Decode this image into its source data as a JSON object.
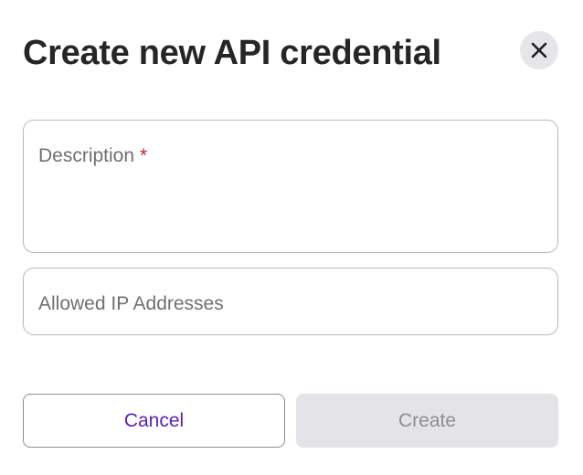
{
  "dialog": {
    "title": "Create new API credential",
    "close_icon": "close-icon"
  },
  "form": {
    "description": {
      "label": "Description",
      "required_marker": "*",
      "value": ""
    },
    "allowed_ips": {
      "label": "Allowed IP Addresses",
      "value": ""
    }
  },
  "actions": {
    "cancel_label": "Cancel",
    "create_label": "Create",
    "create_disabled": true
  },
  "colors": {
    "accent": "#5a1ebe",
    "required": "#c0262d",
    "disabled_bg": "#e3e3e8",
    "close_bg": "#e6e6ea"
  }
}
